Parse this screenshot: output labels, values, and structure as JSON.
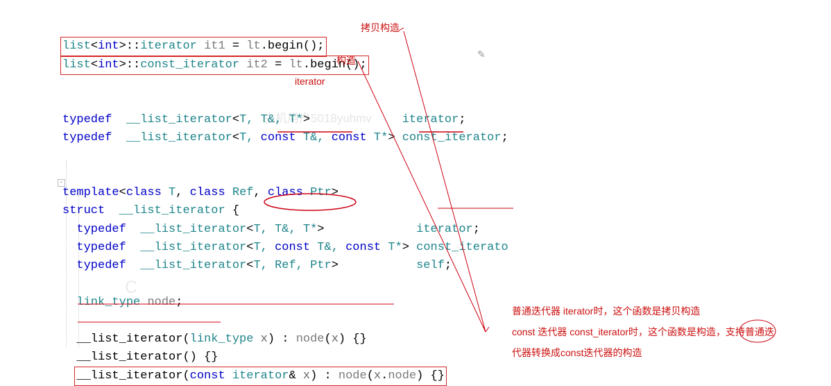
{
  "annotations": {
    "copy_ctor": "拷贝构造",
    "ctor": "构造",
    "iterator_label": "iterator",
    "note1": "普通迭代器 iterator时，这个函数是拷贝构造",
    "note2": "const 迭代器 const_iterator时，这个函数是构造，支持普通迭",
    "note3": "代器转换成const迭代器的构造"
  },
  "watermark": {
    "line1": "主机用户5018yuhmv",
    "line2": "C"
  },
  "code": {
    "l1_a": "list",
    "l1_b": "int",
    "l1_c": "iterator",
    "l1_d": "it1",
    "l1_e": "lt",
    "l1_f": "begin",
    "l2_a": "list",
    "l2_b": "int",
    "l2_c": "const_iterator",
    "l2_d": "it2",
    "l2_e": "lt",
    "l2_f": "begin",
    "l3_a": "typedef",
    "l3_b": "__list_iterator",
    "l3_c": "T, T&, T*",
    "l3_d": "iterator",
    "l4_a": "typedef",
    "l4_b": "__list_iterator",
    "l4_c": "T, ",
    "l4_c2": "const",
    "l4_c3": " T&, ",
    "l4_c4": "const",
    "l4_c5": " T*",
    "l4_d": "const_iterator",
    "l5_a": "template",
    "l5_b": "class",
    "l5_c": "T",
    "l5_d": "class",
    "l5_e": "Ref",
    "l5_f": "class",
    "l5_g": "Ptr",
    "l6_a": "struct",
    "l6_b": "__list_iterator",
    "l7_a": "typedef",
    "l7_b": "__list_iterator",
    "l7_c": "T, T&, T*",
    "l7_d": "iterator",
    "l8_a": "typedef",
    "l8_b": "__list_iterator",
    "l8_c": "T, ",
    "l8_c2": "const",
    "l8_c3": " T&, ",
    "l8_c4": "const",
    "l8_c5": " T*",
    "l8_d": "const_iterato",
    "l9_a": "typedef",
    "l9_b": "__list_iterator",
    "l9_c": "T, Ref, Ptr",
    "l9_d": "self",
    "l10_a": "link_type",
    "l10_b": "node",
    "l11_a": "__list_iterator",
    "l11_b": "link_type",
    "l11_c": "x",
    "l11_d": "node",
    "l11_e": "x",
    "l12_a": "__list_iterator",
    "l13_a": "__list_iterator",
    "l13_b": "const",
    "l13_c": "iterator",
    "l13_d": "x",
    "l13_e": "node",
    "l13_f": "x",
    "l13_g": "node"
  }
}
